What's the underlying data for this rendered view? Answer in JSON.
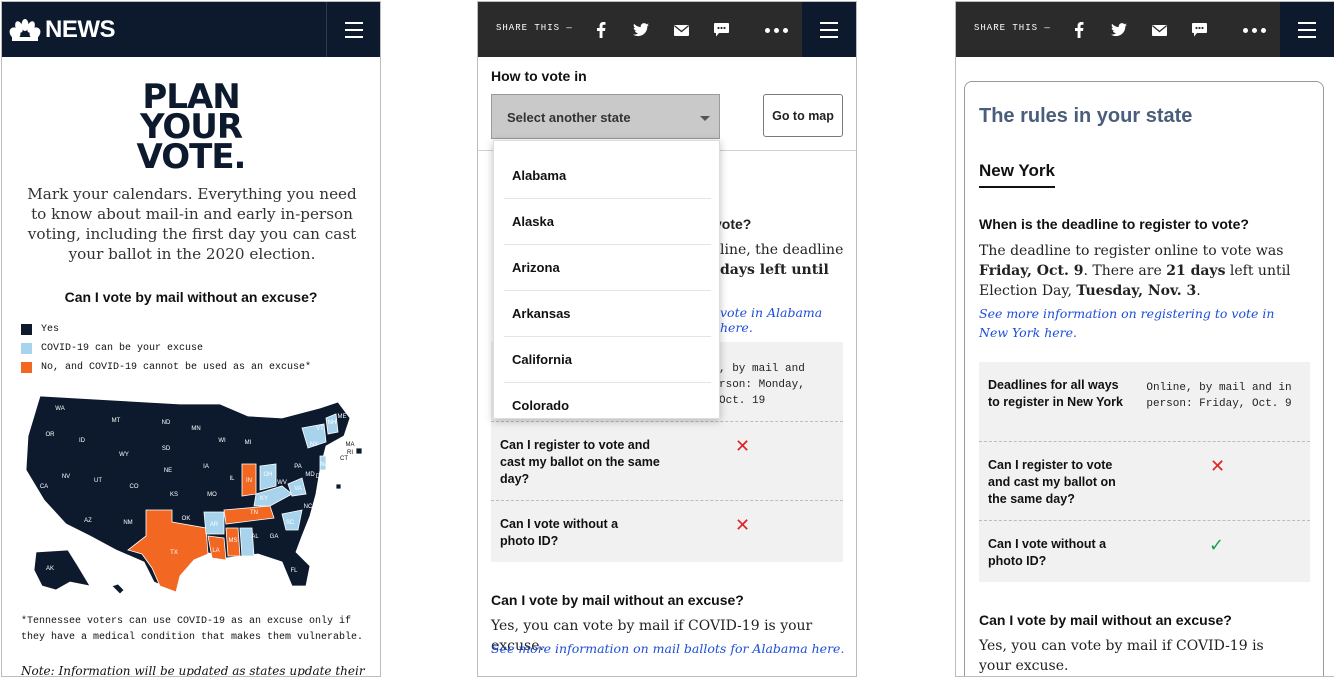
{
  "panel1": {
    "brand": "NEWS",
    "title_lines": [
      "PLAN",
      "YOUR",
      "VOTE."
    ],
    "intro": "Mark your calendars. Everything you need to know about mail-in and early in-person voting, including the first day you can cast your ballot in the 2020 election.",
    "map_question": "Can I vote by mail without an excuse?",
    "legend": [
      {
        "label": "Yes",
        "color": "#0d1a2e"
      },
      {
        "label": "COVID-19 can be your excuse",
        "color": "#a7d3ec"
      },
      {
        "label": "No, and COVID-19 cannot be used as an excuse*",
        "color": "#f26722"
      }
    ],
    "state_labels": [
      "WA",
      "OR",
      "ID",
      "MT",
      "ND",
      "MN",
      "WI",
      "MI",
      "NY",
      "VT",
      "NH",
      "ME",
      "MA",
      "RI",
      "CT",
      "NJ",
      "DE",
      "MD",
      "PA",
      "SD",
      "WY",
      "NE",
      "IA",
      "IL",
      "IN",
      "OH",
      "WV",
      "VA",
      "NV",
      "UT",
      "CO",
      "KS",
      "MO",
      "KY",
      "TN",
      "NC",
      "SC",
      "CA",
      "AZ",
      "NM",
      "OK",
      "AR",
      "MS",
      "AL",
      "GA",
      "TX",
      "LA",
      "FL",
      "AK",
      "HI"
    ],
    "footnote": "*Tennessee voters can use COVID-19 as an excuse only if they have a medical condition that makes them vulnerable.",
    "note": "Note: Information will be updated as states update their"
  },
  "panel2": {
    "share_label": "SHARE THIS —",
    "heading": "How to vote in",
    "select_placeholder": "Select another state",
    "goto_map": "Go to map",
    "dropdown_states": [
      "Alabama",
      "Alaska",
      "Arizona",
      "Arkansas",
      "California",
      "Colorado"
    ],
    "behind_fragments": {
      "q1_tail": "vote?",
      "line1_tail": "line, the deadline",
      "line2_tail": "days left until",
      "link_tail": "vote in Alabama here.",
      "mono1": ", by mail and",
      "mono2": "rson: Monday,",
      "mono3": "Oct. 19"
    },
    "table": [
      {
        "question": "Can I register to vote and cast my ballot on the same day?",
        "mark": "✕"
      },
      {
        "question": "Can I vote without a photo ID?",
        "mark": "✕"
      }
    ],
    "mail_heading": "Can I vote by mail without an excuse?",
    "mail_text": "Yes, you can vote by mail if COVID-19 is your excuse.",
    "mail_link": "See more information on mail ballots for Alabama here."
  },
  "panel3": {
    "share_label": "SHARE THIS —",
    "title": "The rules in your state",
    "state": "New York",
    "deadline_heading": "When is the deadline to register to vote?",
    "deadline_p1": "The deadline to register online to vote was ",
    "deadline_date": "Friday, Oct. 9",
    "deadline_p2": ". There are ",
    "deadline_days": "21 days",
    "deadline_p3": " left until Election Day, ",
    "election_day": "Tuesday, Nov. 3",
    "deadline_p4": ".",
    "register_link": "See more information on registering to vote in New York here.",
    "table": [
      {
        "question": "Deadlines for all ways to register in New York",
        "answer": "Online, by mail and in person: Friday, Oct. 9"
      },
      {
        "question": "Can I register to vote and cast my ballot on the same day?",
        "mark": "✕"
      },
      {
        "question": "Can I vote without a photo ID?",
        "mark": "✓"
      }
    ],
    "mail_heading": "Can I vote by mail without an excuse?",
    "mail_text": "Yes, you can vote by mail if COVID-19 is your excuse."
  }
}
